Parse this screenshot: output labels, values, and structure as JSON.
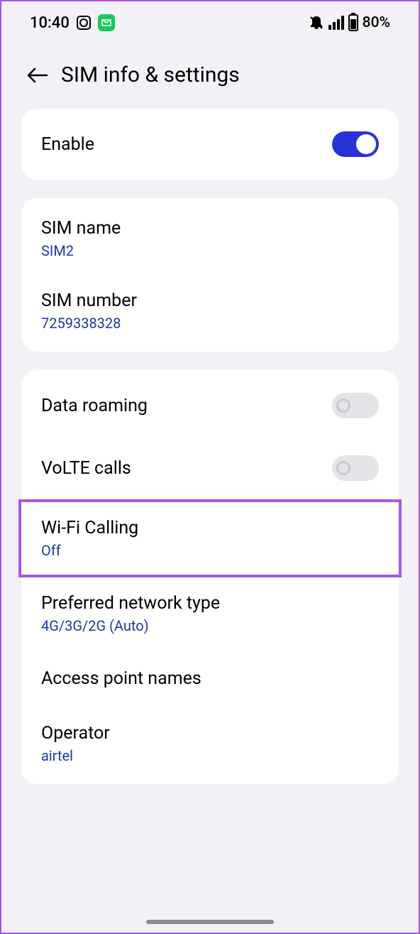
{
  "status": {
    "time": "10:40",
    "battery_pct": "80%"
  },
  "header": {
    "title": "SIM info & settings"
  },
  "enable": {
    "label": "Enable",
    "state": true
  },
  "sim_info": {
    "name_label": "SIM name",
    "name_value": "SIM2",
    "number_label": "SIM number",
    "number_value": "7259338328"
  },
  "settings": {
    "data_roaming": {
      "label": "Data roaming",
      "state": false
    },
    "volte": {
      "label": "VoLTE calls",
      "state": false
    },
    "wifi_calling": {
      "label": "Wi-Fi Calling",
      "value": "Off"
    },
    "network_type": {
      "label": "Preferred network type",
      "value": "4G/3G/2G (Auto)"
    },
    "apn": {
      "label": "Access point names"
    },
    "operator": {
      "label": "Operator",
      "value": "airtel"
    }
  }
}
